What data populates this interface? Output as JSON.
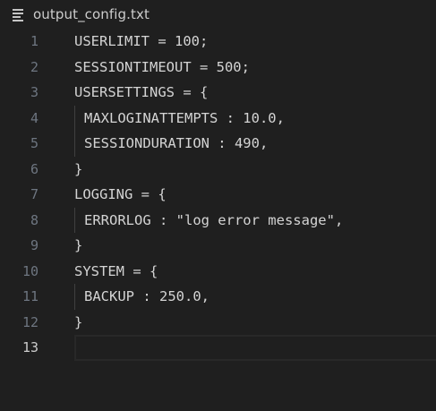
{
  "tab": {
    "file_icon": "lines-file-icon",
    "file_name": "output_config.txt"
  },
  "colors": {
    "background": "#1f1f1f",
    "text": "#d4d4d4",
    "line_number": "#6e7681",
    "active_line_number": "#cccccc"
  },
  "editor": {
    "active_line": 13,
    "lines": [
      {
        "number": "1",
        "text": "USERLIMIT = 100;"
      },
      {
        "number": "2",
        "text": "SESSIONTIMEOUT = 500;"
      },
      {
        "number": "3",
        "text": "USERSETTINGS = {"
      },
      {
        "number": "4",
        "text": "MAXLOGINATTEMPTS : 10.0,"
      },
      {
        "number": "5",
        "text": "SESSIONDURATION : 490,"
      },
      {
        "number": "6",
        "text": "}"
      },
      {
        "number": "7",
        "text": "LOGGING = {"
      },
      {
        "number": "8",
        "text": "ERRORLOG : \"log error message\","
      },
      {
        "number": "9",
        "text": "}"
      },
      {
        "number": "10",
        "text": "SYSTEM = {"
      },
      {
        "number": "11",
        "text": "BACKUP : 250.0,"
      },
      {
        "number": "12",
        "text": "}"
      },
      {
        "number": "13",
        "text": ""
      }
    ]
  }
}
